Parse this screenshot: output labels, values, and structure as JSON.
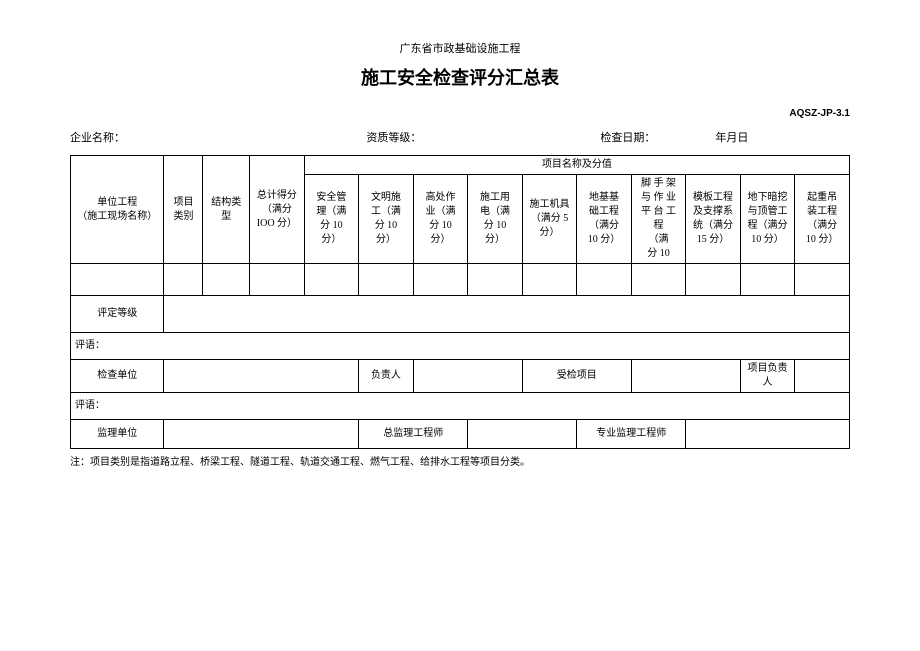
{
  "header": {
    "subtitle": "广东省市政基础设施工程",
    "title": "施工安全检查评分汇总表",
    "doc_code": "AQSZ-JP-3.1"
  },
  "info": {
    "company_label": "企业名称：",
    "grade_label": "资质等级：",
    "check_date_label": "检查日期：",
    "date_suffix": "年月日"
  },
  "table": {
    "col_unit": "单位工程\n（施工现场名称）",
    "col_category": "项目\n类别",
    "col_structure": "结构类\n型",
    "col_total": "总计得分\n（满分\nIOO 分）",
    "group_header": "项目名称及分值",
    "c1": "安全管\n理（满\n分 10\n分）",
    "c2": "文明施\n工（满\n分 10\n分）",
    "c3": "高处作\n业（满\n分 10\n分）",
    "c4": "施工用\n电（满\n分 10\n分）",
    "c5": "施工机具\n（满分 5\n分）",
    "c6": "地基基\n础工程\n（满分\n10 分）",
    "c7": "脚 手 架\n与 作 业\n平 台 工\n程\n（满\n分 10",
    "c8": "模板工程\n及支撑系\n统（满分\n15 分）",
    "c9": "地下暗挖\n与顶管工\n程（满分\n10 分）",
    "c10": "起重吊\n装工程\n（满分\n10 分）",
    "assess_label": "评定等级",
    "pingyu_label": "评语：",
    "check_unit": "检查单位",
    "responsible": "负责人",
    "inspected_project": "受检项目",
    "project_responsible": "项目负责人",
    "supervisor_unit": "监理单位",
    "chief_supervisor": "总监理工程师",
    "pro_supervisor": "专业监理工程师"
  },
  "note": "注：项目类别是指道路立程、桥梁工程、隧道工程、轨道交通工程、燃气工程、给排水工程等项目分类。"
}
